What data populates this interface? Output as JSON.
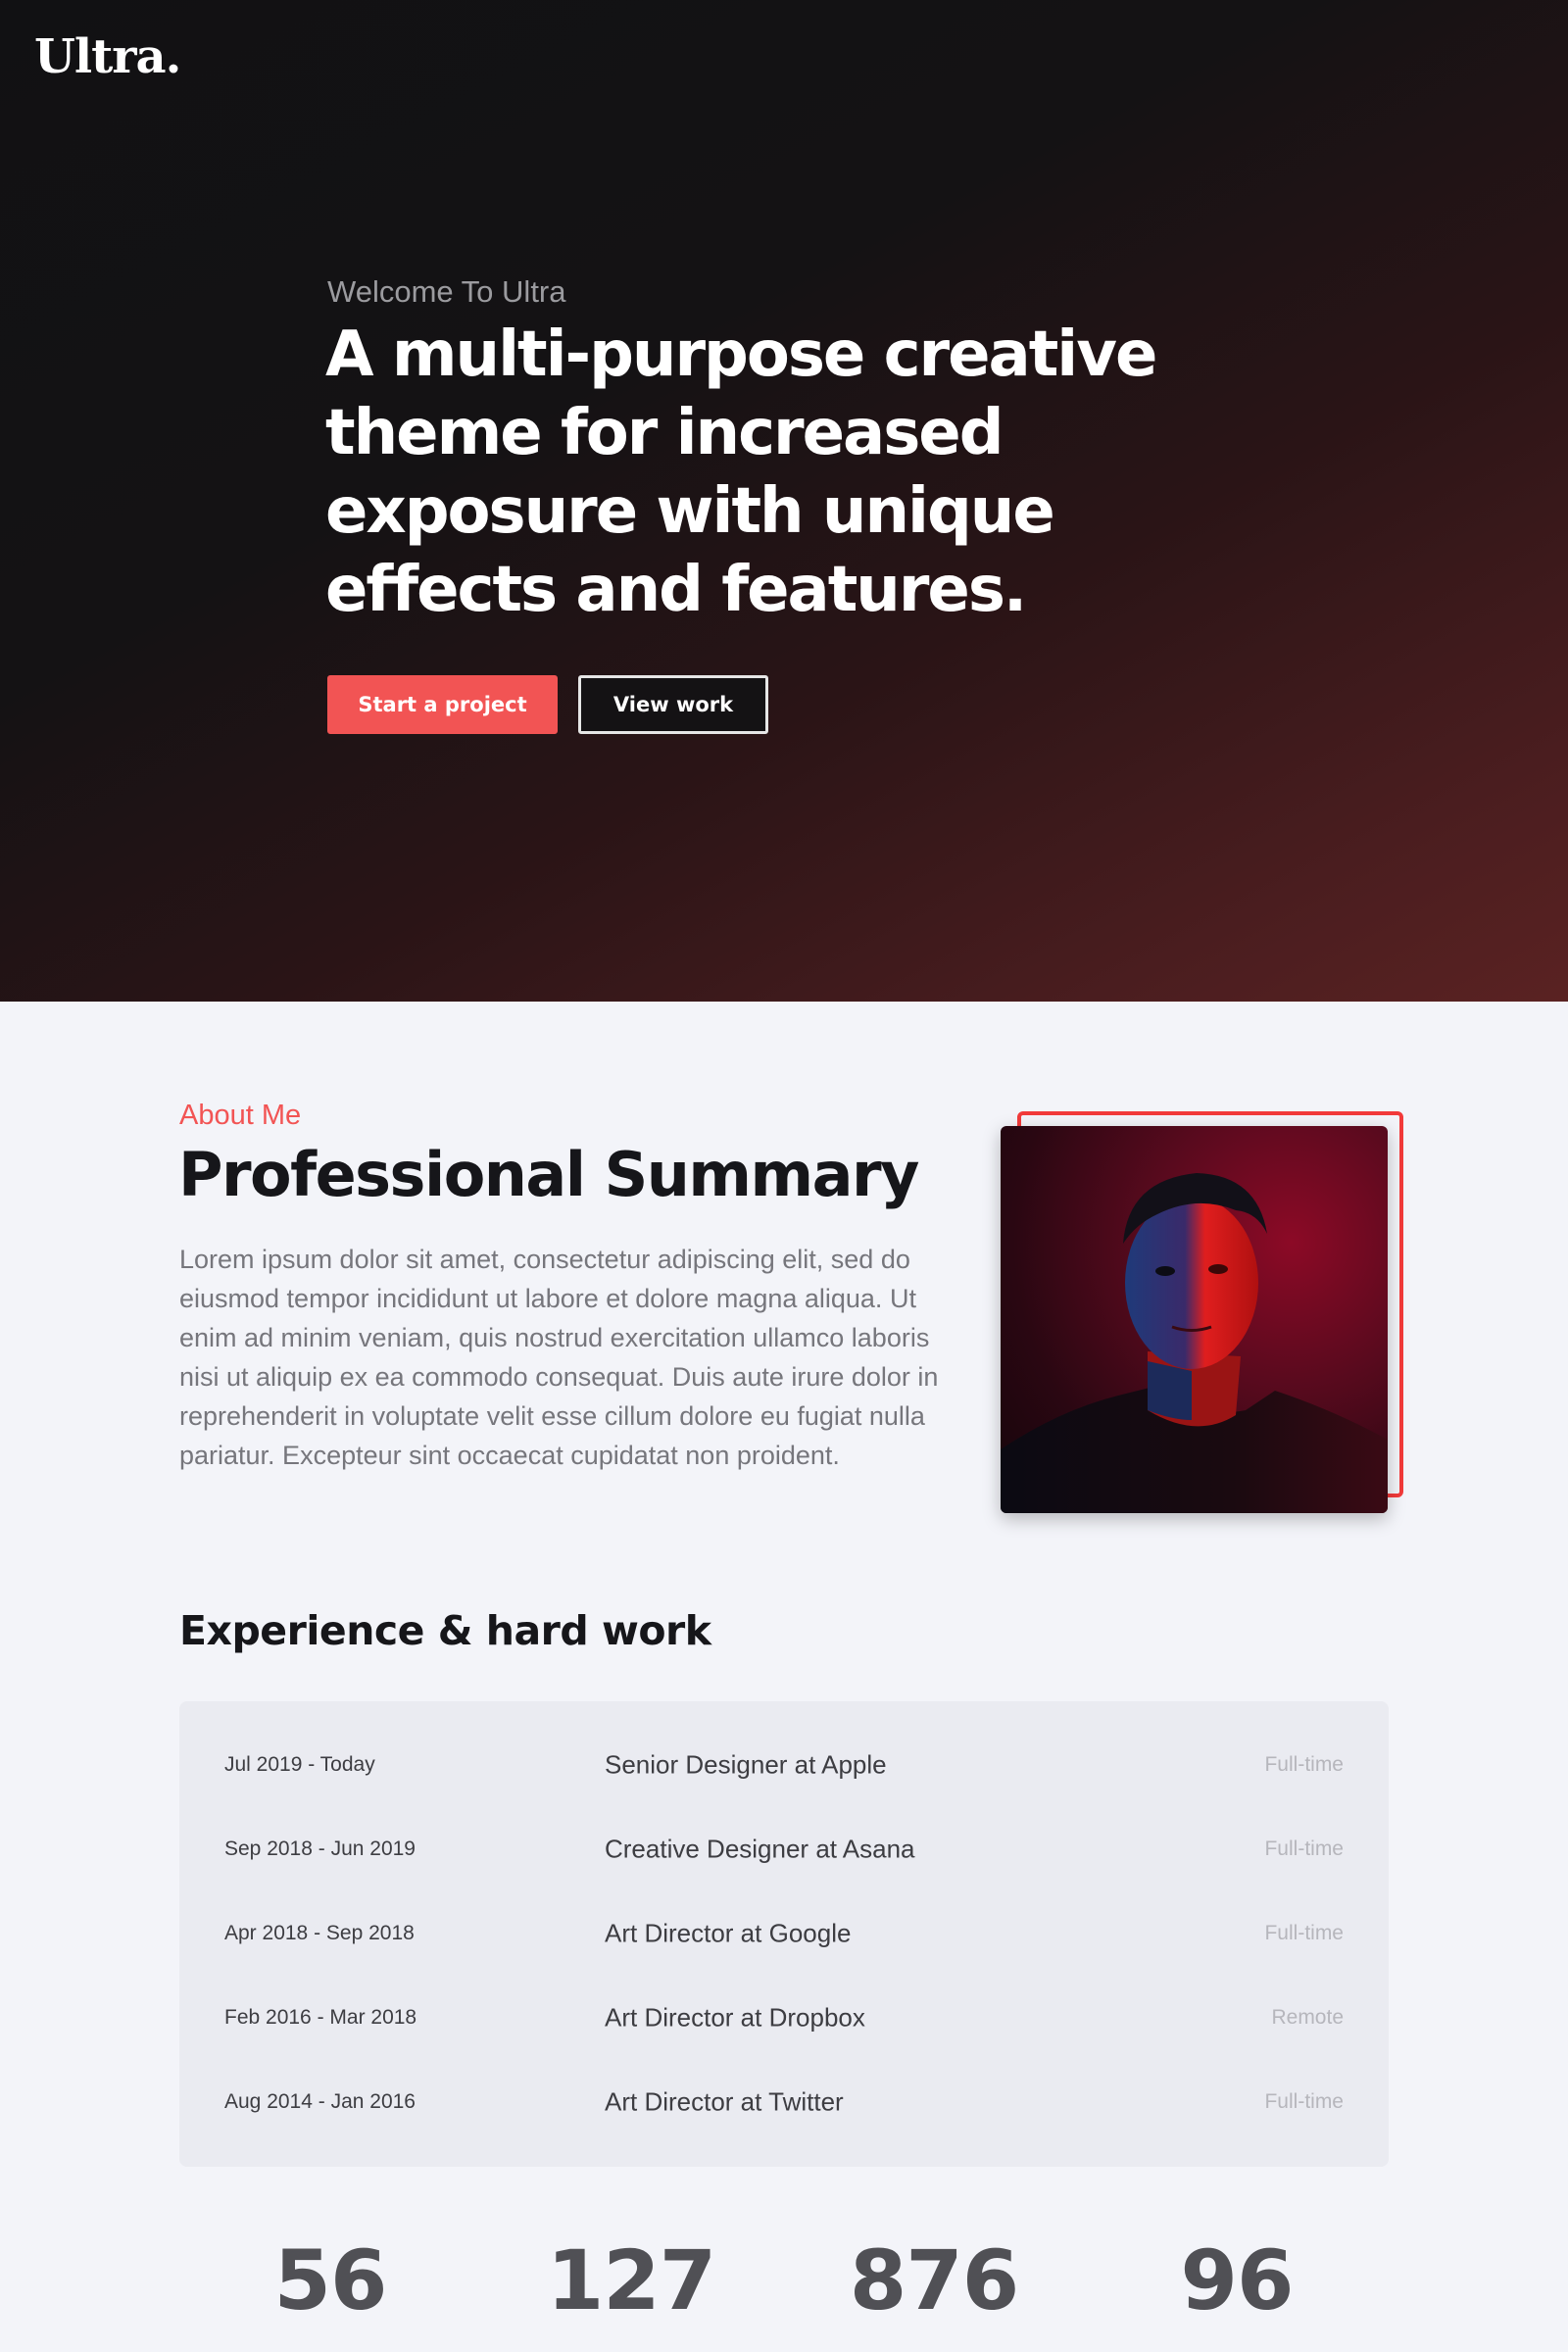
{
  "brand": {
    "logo": "Ultra",
    "logo_dot": "."
  },
  "hero": {
    "eyebrow": "Welcome To Ultra",
    "title": "A multi-purpose creative theme for increased exposure with unique effects and features.",
    "primary_button": "Start a project",
    "secondary_button": "View work"
  },
  "about": {
    "eyebrow": "About Me",
    "title": "Professional Summary",
    "body": "Lorem ipsum dolor sit amet, consectetur adipiscing elit, sed do eiusmod tempor incididunt ut labore et dolore magna aliqua. Ut enim ad minim veniam, quis nostrud exercitation ullamco laboris nisi ut aliquip ex ea commodo consequat. Duis aute irure dolor in reprehenderit in voluptate velit esse cillum dolore eu fugiat nulla pariatur. Excepteur sint occaecat cupidatat non proident."
  },
  "experience": {
    "title": "Experience & hard work",
    "rows": [
      {
        "date": "Jul 2019 - Today",
        "role": "Senior Designer at Apple",
        "type": "Full-time"
      },
      {
        "date": "Sep 2018 - Jun 2019",
        "role": "Creative Designer at Asana",
        "type": "Full-time"
      },
      {
        "date": "Apr 2018 - Sep 2018",
        "role": "Art Director at Google",
        "type": "Full-time"
      },
      {
        "date": "Feb 2016 - Mar 2018",
        "role": "Art Director at Dropbox",
        "type": "Remote"
      },
      {
        "date": "Aug 2014 - Jan 2016",
        "role": "Art Director at Twitter",
        "type": "Full-time"
      }
    ]
  },
  "stats": [
    "56",
    "127",
    "876",
    "96"
  ],
  "colors": {
    "accent": "#f25454",
    "hero_dark": "#111113",
    "hero_red": "#5a2222",
    "page_bg": "#f3f4f9"
  }
}
